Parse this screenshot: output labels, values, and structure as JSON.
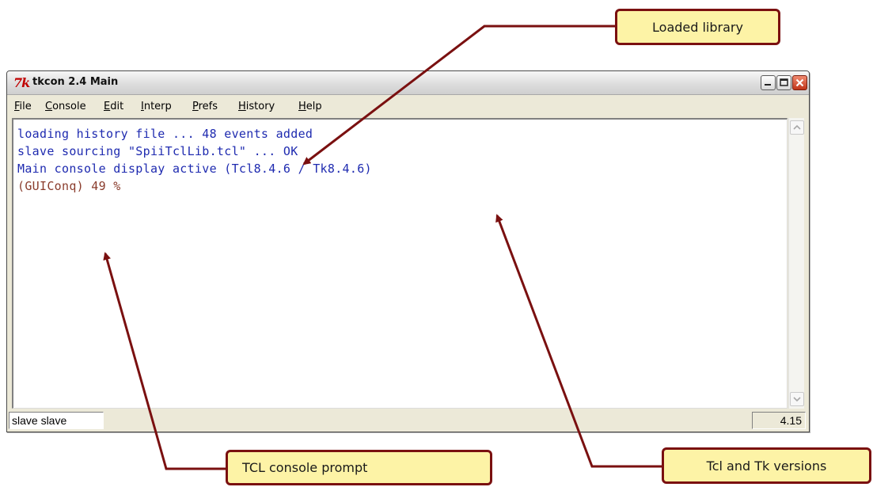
{
  "window": {
    "icon_glyph": "7k",
    "title": "tkcon 2.4 Main",
    "controls": [
      "minimize-icon",
      "maximize-icon",
      "close-icon"
    ]
  },
  "menu": {
    "items": [
      "File",
      "Console",
      "Edit",
      "Interp",
      "Prefs",
      "History",
      "Help"
    ]
  },
  "console": {
    "lines": [
      "loading history file ... 48 events added",
      "slave sourcing \"SpiiTclLib.tcl\" ... OK",
      "Main console display active (Tcl8.4.6 / Tk8.4.6)"
    ],
    "prompt": "(GUIConq) 49 %"
  },
  "status": {
    "left": "slave slave",
    "right": "4.15"
  },
  "callouts": {
    "loaded_library": "Loaded library",
    "versions": "Tcl and Tk versions",
    "prompt": "TCL console prompt"
  },
  "colors": {
    "output_text": "#1f2bb0",
    "prompt_text": "#8a3c2c",
    "callout_fill": "#fdf3a6",
    "callout_border": "#7a1010",
    "arrow": "#7a1010"
  }
}
